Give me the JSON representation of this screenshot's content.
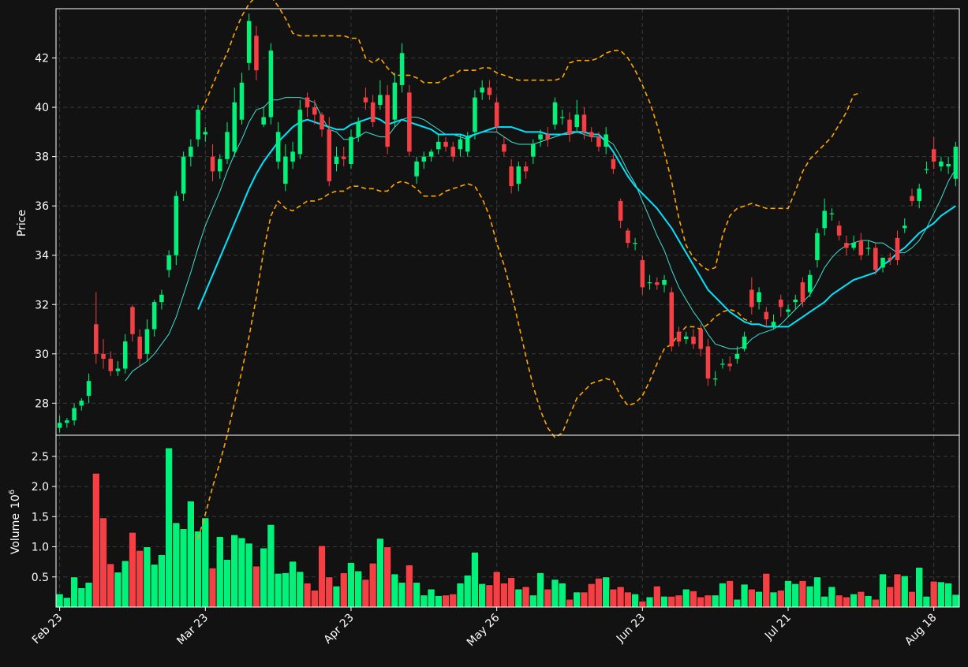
{
  "chart_data": {
    "type": "candlestick",
    "colors": {
      "background": "#121212",
      "up": "#00f27a",
      "down": "#f43f45",
      "grid": "#3a3a3a",
      "axis": "#ffffff",
      "ma_short": "#40e0d0",
      "ma_long": "#00e5ff",
      "bands": "#ffa500"
    },
    "x_tick_labels": [
      "Feb 23",
      "Mar 23",
      "Apr 23",
      "May 26",
      "Jun 23",
      "Jul 21",
      "Aug 18"
    ],
    "x_tick_index": [
      0,
      20,
      40,
      60,
      80,
      100,
      120
    ],
    "n_sessions": 124,
    "price_panel": {
      "ylabel": "Price",
      "ylim": [
        26.7,
        44.0
      ],
      "yticks": [
        28,
        30,
        32,
        34,
        36,
        38,
        40,
        42
      ]
    },
    "volume_panel": {
      "ylabel": "Volume",
      "scale_label": "10",
      "scale_exponent": "6",
      "ylim": [
        0,
        2.85
      ],
      "yticks": [
        0.5,
        1.0,
        1.5,
        2.0,
        2.5
      ],
      "ytick_labels": [
        "0.5",
        "1.0",
        "1.5",
        "2.0",
        "2.5"
      ]
    },
    "close": [
      27.2,
      27.3,
      27.8,
      28.1,
      28.9,
      30.0,
      29.8,
      29.3,
      29.4,
      30.5,
      30.8,
      29.8,
      31.0,
      32.1,
      32.4,
      34.0,
      36.4,
      38.0,
      38.4,
      39.9,
      39.0,
      37.4,
      37.9,
      39.0,
      40.2,
      41.0,
      43.5,
      41.5,
      39.6,
      42.3,
      39.0,
      38.0,
      38.2,
      39.9,
      40.0,
      39.7,
      39.1,
      37.0,
      38.0,
      37.9,
      38.8,
      39.4,
      40.2,
      39.4,
      40.5,
      38.4,
      41.0,
      42.2,
      38.2,
      37.8,
      38.0,
      38.2,
      38.6,
      38.4,
      38.0,
      38.7,
      38.8,
      40.4,
      40.8,
      40.5,
      39.2,
      38.2,
      36.8,
      37.6,
      37.4,
      38.5,
      38.9,
      38.7,
      40.2,
      39.6,
      38.9,
      39.7,
      39.0,
      38.8,
      38.4,
      38.9,
      37.5,
      35.4,
      34.5,
      34.5,
      32.7,
      32.9,
      32.8,
      33.0,
      30.3,
      30.5,
      30.7,
      30.4,
      30.2,
      29.0,
      29.0,
      29.6,
      29.5,
      30.0,
      30.7,
      31.9,
      32.5,
      31.4,
      31.3,
      31.9,
      31.8,
      32.2,
      32.1,
      33.2,
      34.9,
      35.8,
      35.7,
      34.8,
      34.3,
      34.5,
      34.0,
      34.3,
      33.4,
      33.9,
      33.8,
      33.8,
      35.2,
      36.2,
      36.7,
      37.5,
      37.8,
      37.8,
      37.7,
      38.4
    ],
    "open": [
      27.0,
      27.2,
      27.3,
      27.9,
      28.3,
      31.2,
      30.0,
      29.8,
      29.3,
      29.4,
      31.9,
      30.7,
      30.0,
      31.0,
      32.1,
      33.4,
      34.0,
      36.5,
      38.0,
      38.7,
      38.9,
      38.0,
      37.4,
      37.9,
      38.2,
      39.5,
      41.8,
      42.9,
      39.3,
      39.6,
      37.8,
      36.9,
      37.8,
      38.1,
      40.4,
      40.0,
      39.7,
      39.1,
      37.7,
      38.0,
      37.7,
      38.8,
      40.4,
      40.2,
      40.1,
      40.5,
      39.5,
      40.9,
      40.6,
      37.2,
      37.8,
      38.0,
      38.3,
      38.6,
      38.4,
      38.3,
      38.2,
      39.0,
      40.6,
      40.8,
      40.2,
      38.5,
      37.6,
      36.9,
      37.6,
      38.0,
      38.7,
      38.9,
      39.3,
      39.6,
      39.5,
      39.2,
      39.7,
      39.0,
      38.8,
      38.4,
      37.9,
      36.2,
      35.0,
      34.5,
      33.8,
      32.9,
      32.9,
      32.8,
      32.5,
      30.9,
      30.6,
      30.7,
      31.0,
      30.3,
      29.0,
      29.6,
      29.6,
      29.8,
      30.2,
      32.6,
      32.1,
      31.7,
      31.1,
      32.2,
      31.7,
      32.1,
      32.9,
      32.5,
      33.8,
      35.1,
      35.7,
      35.2,
      34.5,
      34.3,
      34.6,
      34.3,
      34.3,
      33.5,
      33.9,
      34.7,
      35.1,
      36.4,
      36.2,
      37.5,
      38.3,
      37.6,
      37.6,
      37.1
    ],
    "high": [
      27.5,
      27.4,
      28.0,
      28.2,
      29.2,
      32.5,
      30.6,
      30.1,
      29.7,
      30.8,
      32.0,
      31.0,
      31.4,
      32.2,
      32.6,
      34.2,
      36.6,
      38.2,
      38.7,
      40.1,
      39.2,
      38.5,
      38.1,
      39.4,
      40.8,
      41.4,
      43.8,
      43.3,
      40.0,
      42.6,
      39.4,
      38.5,
      38.6,
      40.3,
      40.6,
      40.3,
      39.8,
      39.6,
      38.4,
      38.4,
      39.1,
      39.6,
      40.8,
      40.5,
      41.1,
      40.9,
      41.4,
      42.6,
      40.9,
      38.0,
      38.2,
      38.3,
      38.9,
      38.8,
      38.6,
      38.9,
      39.0,
      40.7,
      41.1,
      41.1,
      40.4,
      38.8,
      37.9,
      37.8,
      37.8,
      38.7,
      39.1,
      39.2,
      40.4,
      39.9,
      39.8,
      40.3,
      40.0,
      39.2,
      39.0,
      39.2,
      38.1,
      36.3,
      35.1,
      34.7,
      34.0,
      33.2,
      33.1,
      33.2,
      32.7,
      31.1,
      30.9,
      31.0,
      31.2,
      30.6,
      29.3,
      29.8,
      29.9,
      30.3,
      30.9,
      33.1,
      32.7,
      31.9,
      31.6,
      32.4,
      32.0,
      32.4,
      33.1,
      33.4,
      35.1,
      36.3,
      35.9,
      35.4,
      34.8,
      34.8,
      34.9,
      34.6,
      34.5,
      33.8,
      34.1,
      35.0,
      35.5,
      36.7,
      36.9,
      37.8,
      38.8,
      38.0,
      38.0,
      38.6
    ],
    "low": [
      26.8,
      27.0,
      27.1,
      27.7,
      28.0,
      29.6,
      29.4,
      29.1,
      29.1,
      29.2,
      30.5,
      29.5,
      29.7,
      30.7,
      31.8,
      33.1,
      33.6,
      36.2,
      37.6,
      38.4,
      38.6,
      37.0,
      37.1,
      37.7,
      38.0,
      39.3,
      41.5,
      41.1,
      39.2,
      39.3,
      37.5,
      36.6,
      37.5,
      37.9,
      39.6,
      39.3,
      38.8,
      36.8,
      37.4,
      37.6,
      37.5,
      38.6,
      39.9,
      39.2,
      39.9,
      38.1,
      39.2,
      40.6,
      38.0,
      36.9,
      37.5,
      37.8,
      38.1,
      38.2,
      37.8,
      38.0,
      38.0,
      38.7,
      40.3,
      40.3,
      39.0,
      38.0,
      36.5,
      36.6,
      37.1,
      37.7,
      38.4,
      38.4,
      39.1,
      39.3,
      38.6,
      39.0,
      38.7,
      38.6,
      38.2,
      38.1,
      37.3,
      35.1,
      34.3,
      34.2,
      32.4,
      32.6,
      32.6,
      32.5,
      30.1,
      30.3,
      30.4,
      30.2,
      29.9,
      28.7,
      28.7,
      29.4,
      29.3,
      29.6,
      30.1,
      31.6,
      31.8,
      31.1,
      31.0,
      31.5,
      31.5,
      31.8,
      31.9,
      32.3,
      33.5,
      34.8,
      35.4,
      34.6,
      34.0,
      34.2,
      33.8,
      34.0,
      33.2,
      33.3,
      33.6,
      33.6,
      34.9,
      36.0,
      35.9,
      37.3,
      37.5,
      37.4,
      37.3,
      36.8
    ],
    "ma_short": [
      null,
      null,
      null,
      null,
      null,
      null,
      null,
      null,
      null,
      28.9,
      29.3,
      29.5,
      29.7,
      30.0,
      30.4,
      30.8,
      31.5,
      32.4,
      33.3,
      34.3,
      35.2,
      35.9,
      36.6,
      37.4,
      38.1,
      38.7,
      39.4,
      39.9,
      40.0,
      40.3,
      40.3,
      40.4,
      40.4,
      40.4,
      40.3,
      40.2,
      39.6,
      39.1,
      39.0,
      38.7,
      38.7,
      38.8,
      39.0,
      38.9,
      38.8,
      38.8,
      39.2,
      39.5,
      39.6,
      39.6,
      39.5,
      39.3,
      39.1,
      38.9,
      38.9,
      38.8,
      38.7,
      38.9,
      39.0,
      39.0,
      39.0,
      38.8,
      38.6,
      38.5,
      38.5,
      38.5,
      38.6,
      38.7,
      38.8,
      38.9,
      38.9,
      39.0,
      38.9,
      38.8,
      38.8,
      38.7,
      38.5,
      38.0,
      37.4,
      36.9,
      36.2,
      35.5,
      34.8,
      34.2,
      33.4,
      32.7,
      32.2,
      31.7,
      31.3,
      30.8,
      30.4,
      30.3,
      30.2,
      30.2,
      30.3,
      30.6,
      30.8,
      30.9,
      31.0,
      31.2,
      31.5,
      31.8,
      32.1,
      32.4,
      32.9,
      33.5,
      33.9,
      34.2,
      34.4,
      34.5,
      34.6,
      34.6,
      34.5,
      34.5,
      34.3,
      34.1,
      34.1,
      34.3,
      34.6,
      35.1,
      35.7,
      36.3,
      37.0,
      37.5
    ],
    "ma_long": [
      null,
      null,
      null,
      null,
      null,
      null,
      null,
      null,
      null,
      null,
      null,
      null,
      null,
      null,
      null,
      null,
      null,
      null,
      null,
      31.8,
      32.5,
      33.2,
      33.9,
      34.6,
      35.3,
      36.0,
      36.7,
      37.3,
      37.8,
      38.2,
      38.6,
      38.9,
      39.2,
      39.4,
      39.5,
      39.4,
      39.3,
      39.2,
      39.1,
      39.1,
      39.3,
      39.4,
      39.5,
      39.6,
      39.5,
      39.3,
      39.4,
      39.5,
      39.4,
      39.3,
      39.2,
      39.1,
      38.9,
      38.9,
      38.9,
      38.9,
      38.8,
      38.9,
      39.0,
      39.1,
      39.2,
      39.2,
      39.2,
      39.1,
      39.0,
      39.0,
      39.0,
      38.9,
      38.9,
      38.9,
      39.0,
      39.0,
      39.0,
      38.9,
      38.9,
      38.6,
      38.2,
      37.7,
      37.2,
      36.8,
      36.5,
      36.2,
      35.9,
      35.5,
      35.1,
      34.6,
      34.1,
      33.6,
      33.1,
      32.6,
      32.3,
      32.0,
      31.7,
      31.5,
      31.3,
      31.2,
      31.2,
      31.1,
      31.1,
      31.1,
      31.1,
      31.3,
      31.5,
      31.7,
      31.9,
      32.1,
      32.4,
      32.6,
      32.8,
      33.0,
      33.1,
      33.2,
      33.3,
      33.6,
      33.8,
      34.1,
      34.3,
      34.6,
      34.9,
      35.1,
      35.3,
      35.6,
      35.8,
      36.0
    ],
    "band_upper": [
      null,
      null,
      null,
      null,
      null,
      null,
      null,
      null,
      null,
      null,
      null,
      null,
      null,
      null,
      null,
      null,
      null,
      null,
      null,
      39.6,
      40.2,
      40.9,
      41.6,
      42.2,
      43.0,
      43.7,
      44.2,
      44.5,
      44.5,
      44.5,
      44.1,
      43.6,
      43.0,
      42.9,
      42.9,
      42.9,
      42.9,
      42.9,
      42.9,
      42.9,
      42.8,
      42.8,
      42.0,
      41.8,
      42.0,
      41.6,
      41.3,
      41.3,
      41.3,
      41.2,
      41.0,
      41.0,
      41.0,
      41.2,
      41.3,
      41.5,
      41.5,
      41.5,
      41.6,
      41.6,
      41.4,
      41.3,
      41.2,
      41.1,
      41.1,
      41.1,
      41.1,
      41.1,
      41.1,
      41.2,
      41.8,
      41.9,
      41.9,
      41.9,
      42.0,
      42.2,
      42.3,
      42.3,
      42.0,
      41.5,
      40.9,
      40.2,
      39.3,
      38.2,
      37.0,
      35.5,
      34.4,
      33.9,
      33.6,
      33.4,
      33.5,
      34.8,
      35.6,
      35.9,
      36.0,
      36.1,
      36.0,
      35.9,
      35.9,
      35.9,
      35.9,
      36.6,
      37.4,
      37.9,
      38.2,
      38.5,
      38.8,
      39.3,
      39.8,
      40.5,
      40.6
    ],
    "band_lower": [
      null,
      null,
      null,
      null,
      null,
      null,
      null,
      null,
      null,
      null,
      null,
      null,
      null,
      null,
      null,
      null,
      null,
      null,
      null,
      22.5,
      23.5,
      24.6,
      25.6,
      26.7,
      28.0,
      29.3,
      30.7,
      32.3,
      34.2,
      35.6,
      36.2,
      35.9,
      35.8,
      36.0,
      36.2,
      36.2,
      36.3,
      36.5,
      36.6,
      36.6,
      36.8,
      36.8,
      36.7,
      36.7,
      36.6,
      36.6,
      36.9,
      37.0,
      36.9,
      36.7,
      36.4,
      36.4,
      36.4,
      36.6,
      36.7,
      36.8,
      36.9,
      36.8,
      36.3,
      35.6,
      34.5,
      33.6,
      32.5,
      31.2,
      29.9,
      28.7,
      27.7,
      27.0,
      26.6,
      26.8,
      27.5,
      28.2,
      28.5,
      28.8,
      28.9,
      29.0,
      28.9,
      28.3,
      27.9,
      28.0,
      28.3,
      28.9,
      29.6,
      30.2,
      30.4,
      30.8,
      31.1,
      31.1,
      31.0,
      31.2,
      31.5,
      31.7,
      31.8,
      31.7,
      31.4,
      31.3
    ],
    "volume": [
      0.22,
      0.16,
      0.5,
      0.32,
      0.41,
      2.22,
      1.48,
      0.72,
      0.58,
      0.77,
      1.24,
      0.94,
      1.0,
      0.71,
      0.87,
      2.64,
      1.4,
      1.3,
      1.76,
      1.26,
      1.48,
      0.65,
      1.17,
      0.79,
      1.2,
      1.15,
      1.06,
      0.68,
      0.98,
      1.37,
      0.56,
      0.57,
      0.76,
      0.59,
      0.4,
      0.28,
      1.02,
      0.5,
      0.35,
      0.57,
      0.74,
      0.6,
      0.46,
      0.73,
      1.14,
      1.0,
      0.55,
      0.41,
      0.7,
      0.41,
      0.2,
      0.3,
      0.19,
      0.2,
      0.22,
      0.4,
      0.53,
      0.91,
      0.39,
      0.37,
      0.59,
      0.4,
      0.49,
      0.3,
      0.34,
      0.2,
      0.57,
      0.3,
      0.46,
      0.4,
      0.13,
      0.25,
      0.25,
      0.39,
      0.48,
      0.5,
      0.3,
      0.34,
      0.25,
      0.22,
      0.1,
      0.17,
      0.35,
      0.18,
      0.18,
      0.2,
      0.3,
      0.27,
      0.17,
      0.2,
      0.2,
      0.4,
      0.44,
      0.13,
      0.38,
      0.3,
      0.26,
      0.56,
      0.25,
      0.28,
      0.44,
      0.39,
      0.44,
      0.35,
      0.5,
      0.18,
      0.34,
      0.2,
      0.17,
      0.22,
      0.26,
      0.19,
      0.13,
      0.55,
      0.34,
      0.55,
      0.52,
      0.26,
      0.66,
      0.18,
      0.43,
      0.42,
      0.4,
      0.21
    ]
  }
}
